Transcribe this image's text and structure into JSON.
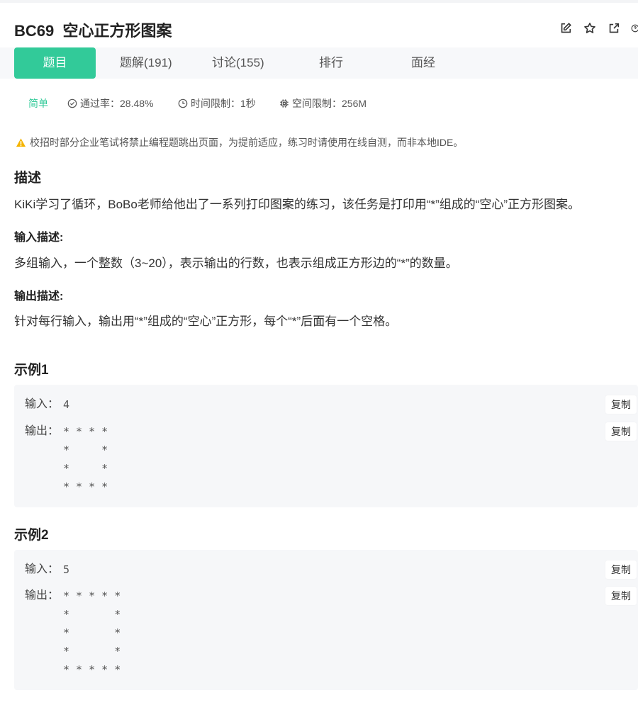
{
  "title": "BC69  空心正方形图案",
  "header_icons": [
    "edit-icon",
    "star-icon",
    "share-icon",
    "help-icon"
  ],
  "tabs": [
    {
      "label": "题目",
      "active": true
    },
    {
      "label": "题解(191)"
    },
    {
      "label": "讨论(155)"
    },
    {
      "label": "排行"
    },
    {
      "label": "面经"
    }
  ],
  "meta": {
    "difficulty": "简单",
    "pass_rate": "通过率：28.48%",
    "time_limit": "时间限制：1秒",
    "memory_limit": "空间限制：256M"
  },
  "notice": "校招时部分企业笔试将禁止编程题跳出页面，为提前适应，练习时请使用在线自测，而非本地IDE。",
  "description": {
    "heading": "描述",
    "text": "KiKi学习了循环，BoBo老师给他出了一系列打印图案的练习，该任务是打印用“*”组成的“空心”正方形图案。"
  },
  "input_desc": {
    "heading": "输入描述:",
    "text": "多组输入，一个整数（3~20），表示输出的行数，也表示组成正方形边的“*”的数量。"
  },
  "output_desc": {
    "heading": "输出描述:",
    "text": "针对每行输入，输出用“*”组成的“空心”正方形，每个“*”后面有一个空格。"
  },
  "examples": [
    {
      "heading": "示例1",
      "input_label": "输入：",
      "input": "4",
      "output_label": "输出：",
      "output": "* * * *\n*     *\n*     *\n* * * *",
      "copy_label": "复制"
    },
    {
      "heading": "示例2",
      "input_label": "输入：",
      "input": "5",
      "output_label": "输出：",
      "output": "* * * * *\n*       *\n*       *\n*       *\n* * * * *",
      "copy_label": "复制"
    }
  ],
  "colors": {
    "accent": "#32ca99",
    "warning": "#f5b400",
    "panel_bg": "#f6f7f9",
    "tabs_bg": "#f7f8fa"
  }
}
